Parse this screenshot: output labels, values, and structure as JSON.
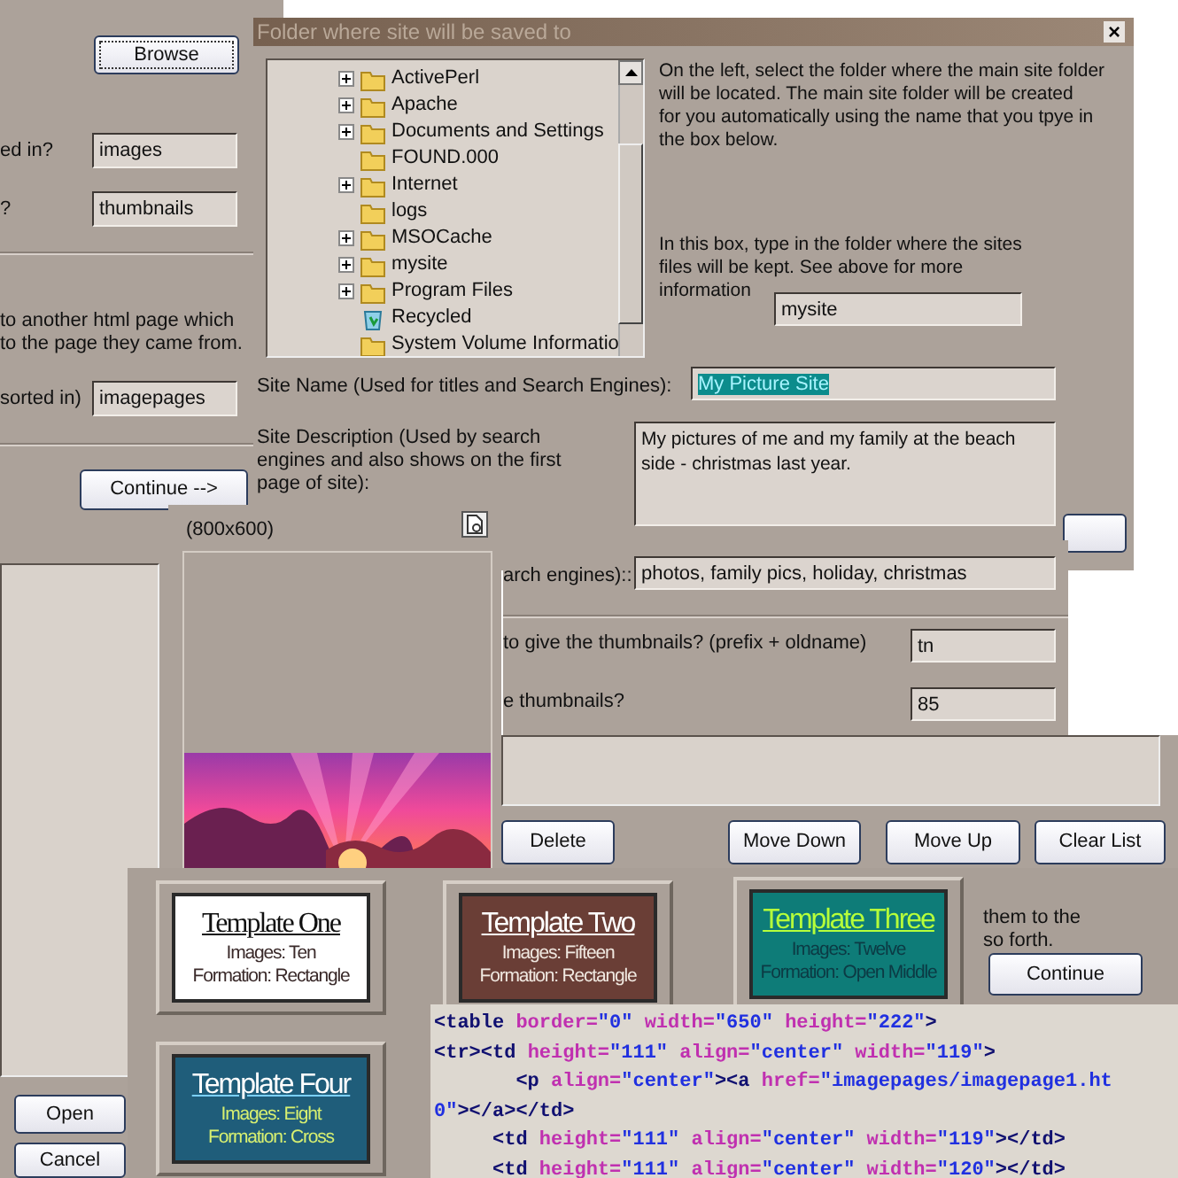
{
  "main_window": {
    "browse_button": {
      "label": "Browse",
      "focused": true
    },
    "fields": [
      {
        "label": "ed in?",
        "value": "images"
      },
      {
        "label": "?",
        "value": "thumbnails"
      }
    ],
    "note_lines": [
      "to another html page which",
      "to the page they came from."
    ],
    "page_field": {
      "label": "sorted in)",
      "value": "imagepages"
    },
    "continue_button": "Continue -->"
  },
  "folder_dialog": {
    "title": "Folder where site will be saved to",
    "close": "×",
    "tree": [
      {
        "label": "ActivePerl",
        "expandable": true,
        "kind": "folder"
      },
      {
        "label": "Apache",
        "expandable": true,
        "kind": "folder"
      },
      {
        "label": "Documents and Settings",
        "expandable": true,
        "kind": "folder"
      },
      {
        "label": "FOUND.000",
        "expandable": false,
        "kind": "folder"
      },
      {
        "label": "Internet",
        "expandable": true,
        "kind": "folder"
      },
      {
        "label": "logs",
        "expandable": false,
        "kind": "folder"
      },
      {
        "label": "MSOCache",
        "expandable": true,
        "kind": "folder"
      },
      {
        "label": "mysite",
        "expandable": true,
        "kind": "folder"
      },
      {
        "label": "Program Files",
        "expandable": true,
        "kind": "folder"
      },
      {
        "label": "Recycled",
        "expandable": false,
        "kind": "recycle"
      },
      {
        "label": "System Volume Informatio",
        "expandable": false,
        "kind": "folder"
      }
    ],
    "help_lines": [
      "On the left, select the folder where the main site folder",
      "will be located. The main site folder will be created",
      "for you automatically using the name that you tpye in",
      "the box below."
    ],
    "prompt_lines": [
      "In this box, type in the folder where the sites",
      "files will be kept. See above for more",
      "information"
    ],
    "folder_value": "mysite",
    "site_name": {
      "label": "Site Name (Used for titles and Search Engines):",
      "value": "My Picture Site",
      "selected": true
    },
    "site_description": {
      "label_lines": [
        "Site Description (Used by search",
        "engines and also shows on the first",
        "page of site):"
      ],
      "value": "My pictures of me and my family at the beach side - christmas last year."
    }
  },
  "thumbnail_settings": {
    "keywords": {
      "label": "arch engines)::",
      "value": "photos, family pics, holiday, christmas"
    },
    "prefix": {
      "label": "to give the thumbnails? (prefix + oldname)",
      "value": "tn"
    },
    "quality": {
      "label": "e thumbnails?",
      "value": "85"
    }
  },
  "open_dialog": {
    "buttons": [
      "Open",
      "Cancel"
    ]
  },
  "preview": {
    "size": "(800x600)",
    "kind": "picture"
  },
  "list_window": {
    "buttons": [
      "Delete",
      "Move Down",
      "Move Up",
      "Clear List"
    ]
  },
  "templates_window": {
    "templates": [
      {
        "title": "Template One",
        "images": "Images: Ten",
        "formation": "Formation: Rectangle",
        "kind": "white"
      },
      {
        "title": "Template Two",
        "images": "Images: Fifteen",
        "formation": "Formation: Rectangle",
        "kind": "brown"
      },
      {
        "title": "Template Three",
        "images": "Images: Twelve",
        "formation": "Formation: Open Middle",
        "kind": "teal"
      },
      {
        "title": "Template Four",
        "images": "Images: Eight",
        "formation": "Formation: Cross",
        "kind": "navy"
      }
    ],
    "note_lines": [
      "them to the",
      "so forth."
    ],
    "continue_button": "Continue"
  },
  "code_view": {
    "lines": [
      [
        {
          "kind": "tag",
          "text": "<table"
        },
        {
          "kind": "attr",
          "text": " border="
        },
        {
          "kind": "value",
          "text": "\"0\""
        },
        {
          "kind": "attr",
          "text": " width="
        },
        {
          "kind": "value",
          "text": "\"650\""
        },
        {
          "kind": "attr",
          "text": " height="
        },
        {
          "kind": "value",
          "text": "\"222\""
        },
        {
          "kind": "tag",
          "text": ">"
        }
      ],
      [
        {
          "kind": "tag",
          "text": "<tr><td"
        },
        {
          "kind": "attr",
          "text": " height="
        },
        {
          "kind": "value",
          "text": "\"111\""
        },
        {
          "kind": "attr",
          "text": " align="
        },
        {
          "kind": "value",
          "text": "\"center\""
        },
        {
          "kind": "attr",
          "text": " width="
        },
        {
          "kind": "value",
          "text": "\"119\""
        },
        {
          "kind": "tag",
          "text": ">"
        }
      ],
      [
        {
          "kind": "tag",
          "text": "       <p"
        },
        {
          "kind": "attr",
          "text": " align="
        },
        {
          "kind": "value",
          "text": "\"center\""
        },
        {
          "kind": "tag",
          "text": "><a"
        },
        {
          "kind": "attr",
          "text": " href="
        },
        {
          "kind": "value",
          "text": "\"imagepages/imagepage1.ht"
        }
      ],
      [
        {
          "kind": "value",
          "text": "0\""
        },
        {
          "kind": "tag",
          "text": "></a></td>"
        }
      ],
      [
        {
          "kind": "tag",
          "text": "     <td"
        },
        {
          "kind": "attr",
          "text": " height="
        },
        {
          "kind": "value",
          "text": "\"111\""
        },
        {
          "kind": "attr",
          "text": " align="
        },
        {
          "kind": "value",
          "text": "\"center\""
        },
        {
          "kind": "attr",
          "text": " width="
        },
        {
          "kind": "value",
          "text": "\"119\""
        },
        {
          "kind": "tag",
          "text": "></td>"
        }
      ],
      [
        {
          "kind": "tag",
          "text": "     <td"
        },
        {
          "kind": "attr",
          "text": " height="
        },
        {
          "kind": "value",
          "text": "\"111\""
        },
        {
          "kind": "attr",
          "text": " align="
        },
        {
          "kind": "value",
          "text": "\"center\""
        },
        {
          "kind": "attr",
          "text": " width="
        },
        {
          "kind": "value",
          "text": "\"120\""
        },
        {
          "kind": "tag",
          "text": "></td>"
        }
      ]
    ]
  }
}
